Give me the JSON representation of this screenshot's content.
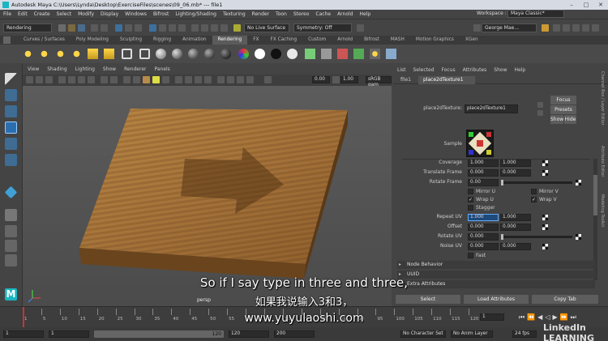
{
  "window": {
    "title": "Autodesk Maya  C:\\Users\\Lynda\\Desktop\\ExerciseFiles\\scenes\\09_06.mb*   ---   file1",
    "workspace_label": "Workspace :",
    "workspace_value": "Maya Classic*"
  },
  "menubar": [
    "File",
    "Edit",
    "Create",
    "Select",
    "Modify",
    "Display",
    "Windows",
    "Bifrost",
    "Lighting/Shading",
    "Texturing",
    "Render",
    "Toon",
    "Stereo",
    "Cache",
    "Arnold",
    "Help"
  ],
  "statusline": {
    "menuset": "Rendering",
    "live_surface": "No Live Surface",
    "symmetry": "Symmetry: Off",
    "user": "George Mae..."
  },
  "shelf_tabs": [
    "Curves / Surfaces",
    "Poly Modeling",
    "Sculpting",
    "Rigging",
    "Animation",
    "Rendering",
    "FX",
    "FX Caching",
    "Custom",
    "Arnold",
    "Bifrost",
    "MASH",
    "Motion Graphics",
    "XGen"
  ],
  "shelf_active": "Rendering",
  "viewport": {
    "menu": [
      "View",
      "Shading",
      "Lighting",
      "Show",
      "Renderer",
      "Panels"
    ],
    "field_a": "0.00",
    "field_b": "1.00",
    "colorspace": "sRGB gam",
    "camera": "persp"
  },
  "attribute_editor": {
    "menu": [
      "List",
      "Selected",
      "Focus",
      "Attributes",
      "Show",
      "Help"
    ],
    "tabs": [
      "file1",
      "place2dTexture1"
    ],
    "node_label": "place2dTexture:",
    "node_value": "place2dTexture1",
    "focus_button": "Focus",
    "presets_button": "Presets",
    "show_button": "Show",
    "hide_button": "Hide",
    "sample_label": "Sample",
    "coverage": {
      "label": "Coverage",
      "u": "1.000",
      "v": "1.000"
    },
    "translate_frame": {
      "label": "Translate Frame",
      "u": "0.000",
      "v": "0.000"
    },
    "rotate_frame": {
      "label": "Rotate Frame",
      "value": "0.00"
    },
    "mirror_u": "Mirror U",
    "mirror_v": "Mirror V",
    "wrap_u": "Wrap U",
    "wrap_v": "Wrap V",
    "stagger": "Stagger",
    "repeat_uv": {
      "label": "Repeat UV",
      "u": "1.000",
      "v": "1.000"
    },
    "offset": {
      "label": "Offset",
      "u": "0.000",
      "v": "0.000"
    },
    "rotate_uv": {
      "label": "Rotate UV",
      "value": "0.000"
    },
    "noise_uv": {
      "label": "Noise UV",
      "u": "0.000",
      "v": "0.000"
    },
    "fast": "Fast",
    "sections": [
      "Node Behavior",
      "UUID",
      "Extra Attributes"
    ],
    "bottom_buttons": [
      "Select",
      "Load Attributes",
      "Copy Tab"
    ]
  },
  "side_tabs": [
    "Channel Box / Layer Editor",
    "Attribute Editor",
    "Modeling Toolkit"
  ],
  "timeline": {
    "ticks": [
      "1",
      "5",
      "10",
      "15",
      "20",
      "25",
      "30",
      "35",
      "40",
      "45",
      "50",
      "55",
      "60",
      "65",
      "70",
      "75",
      "80",
      "85",
      "90",
      "95",
      "100",
      "105",
      "110",
      "115",
      "120"
    ],
    "current_frame": "1"
  },
  "range": {
    "start": "1",
    "start2": "1",
    "end_inner": "120",
    "end": "120",
    "end2": "200",
    "character_set": "No Character Set",
    "anim_layer": "No Anim Layer",
    "fps": "24 fps"
  },
  "branding": "LinkedIn LEARNING",
  "subtitles": {
    "english": "So if I say type in three and three,",
    "chinese": "如果我说输入3和3，",
    "website": "www.yuyulaoshi.com"
  }
}
